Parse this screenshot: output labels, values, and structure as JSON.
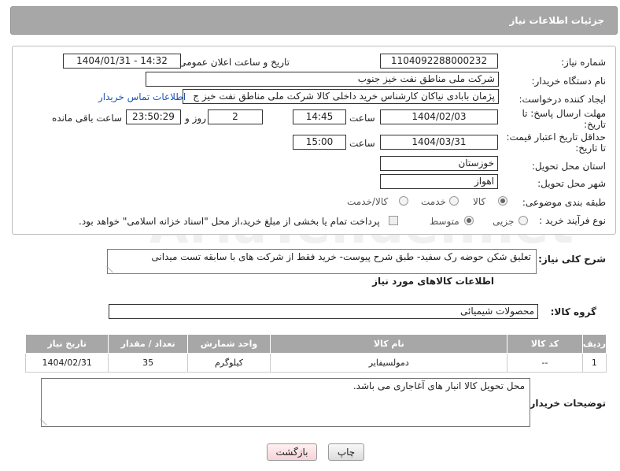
{
  "header": {
    "title": "جزئیات اطلاعات نیاز"
  },
  "form": {
    "need_number_label": "شماره نیاز:",
    "need_number": "1104092288000232",
    "announce_label": "تاریخ و ساعت اعلان عمومی:",
    "announce_value": "1404/01/31 - 14:32",
    "buyer_org_label": "نام دستگاه خریدار:",
    "buyer_org": "شرکت ملی مناطق نفت خیز جنوب",
    "creator_label": "ایجاد کننده درخواست:",
    "creator": "پژمان  بابادی نیاکان  کارشناس خرید داخلی کالا  شرکت ملی مناطق نفت خیز ج",
    "contact_link": "اطلاعات تماس خریدار",
    "deadline_label_1": "مهلت ارسال پاسخ: تا",
    "deadline_label_2": "تاریخ:",
    "deadline_date": "1404/02/03",
    "time_label": "ساعت",
    "deadline_time": "14:45",
    "days_value": "2",
    "days_label": "روز و",
    "remaining_time": "23:50:29",
    "remaining_label": "ساعت باقی مانده",
    "validity_label_1": "حداقل تاریخ اعتبار قیمت:",
    "validity_label_2": "تا تاریخ:",
    "validity_date": "1404/03/31",
    "validity_time": "15:00",
    "province_label": "استان محل تحویل:",
    "province": "خوزستان",
    "city_label": "شهر محل تحویل:",
    "city": "اهواز",
    "category_label": "طبقه بندی موضوعی:",
    "category_options": [
      "کالا",
      "خدمت",
      "کالا/خدمت"
    ],
    "process_label": "نوع فرآیند خرید :",
    "process_options": [
      "جزیی",
      "متوسط"
    ],
    "payment_note": "پرداخت تمام یا بخشی از مبلغ خرید،از محل \"اسناد خزانه اسلامی\" خواهد بود."
  },
  "description": {
    "label": "شرح کلی نیاز:",
    "text": "تعلیق شکن حوضه رک سفید- طبق شرح پیوست- خرید فقط از شرکت های با سابقه تست میدانی"
  },
  "goods": {
    "section_title": "اطلاعات کالاهای مورد نیاز",
    "group_label": "گروه کالا:",
    "group_value": "محصولات شیمیائی",
    "columns": [
      "ردیف",
      "کد کالا",
      "نام کالا",
      "واحد شمارش",
      "تعداد / مقدار",
      "تاریخ نیاز"
    ],
    "rows": [
      {
        "row": "1",
        "code": "--",
        "name": "دمولسیفایر",
        "unit": "کیلوگرم",
        "qty": "35",
        "date": "1404/02/31"
      }
    ]
  },
  "buyer_notes": {
    "label": "توضیحات خریدار:",
    "text": "محل تحویل کالا انبار های آغاجاری می باشد."
  },
  "buttons": {
    "print": "چاپ",
    "back": "بازگشت"
  },
  "watermark": "AriaTender.net"
}
